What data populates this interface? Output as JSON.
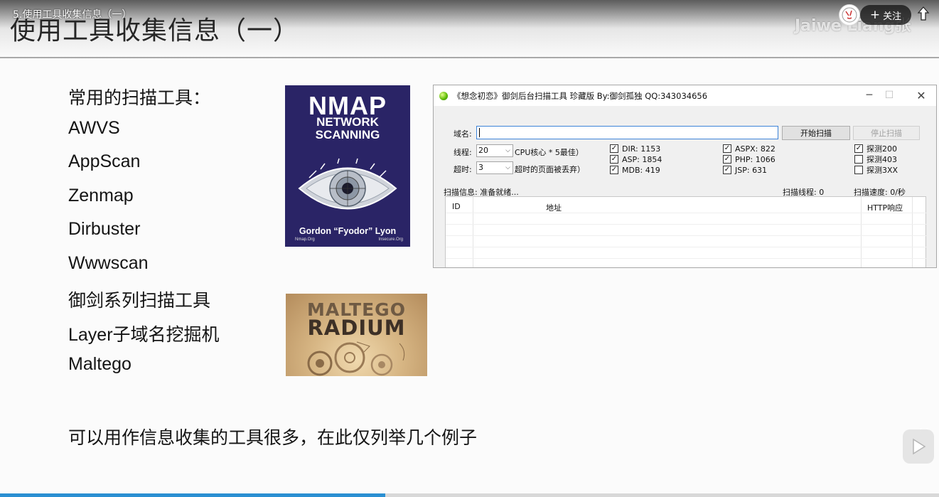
{
  "video": {
    "title": "5.使用工具收集信息（一）",
    "watermark": "Jaiwe  Liang张",
    "follow_label": "关注",
    "progress_percent": 41
  },
  "slide": {
    "title": "使用工具收集信息（一）",
    "heading": "常用的扫描工具：",
    "tools": [
      "AWVS",
      "AppScan",
      "Zenmap",
      "Dirbuster",
      "Wwwscan",
      "御剑系列扫描工具",
      "Layer子域名挖掘机",
      "Maltego"
    ],
    "footer": "可以用作信息收集的工具很多，在此仅列举几个例子"
  },
  "nmap_cover": {
    "title": "NMAP",
    "subtitle1": "NETWORK",
    "subtitle2": "SCANNING",
    "author": "Gordon “Fyodor” Lyon",
    "site_left": "Nmap.Org",
    "site_right": "Insecure.Org"
  },
  "maltego_cover": {
    "line1": "MALTEGO",
    "line2": "RADIUM"
  },
  "scanner": {
    "title": "《想念初恋》御剑后台扫描工具 珍藏版 By:御剑孤独 QQ:343034656",
    "domain_label": "域名:",
    "domain_value": "",
    "start_button": "开始扫描",
    "stop_button": "停止扫描",
    "threads_label": "线程:",
    "threads_value": "20",
    "threads_hint": "CPU核心 * 5最佳）",
    "timeout_label": "超时:",
    "timeout_value": "3",
    "timeout_hint": "超时的页面被丢弃）",
    "dicts": [
      {
        "label": "DIR: 1153",
        "checked": true
      },
      {
        "label": "ASP: 1854",
        "checked": true
      },
      {
        "label": "MDB: 419",
        "checked": true
      },
      {
        "label": "ASPX: 822",
        "checked": true
      },
      {
        "label": "PHP: 1066",
        "checked": true
      },
      {
        "label": "JSP: 631",
        "checked": true
      }
    ],
    "probes": [
      {
        "label": "探测200",
        "checked": true
      },
      {
        "label": "探测403",
        "checked": false
      },
      {
        "label": "探测3XX",
        "checked": false
      }
    ],
    "scan_info": "扫描信息: 准备就绪...",
    "scan_threads": "扫描线程: 0",
    "scan_speed": "扫描速度: 0/秒",
    "columns": {
      "id": "ID",
      "url": "地址",
      "http": "HTTP响应"
    }
  }
}
